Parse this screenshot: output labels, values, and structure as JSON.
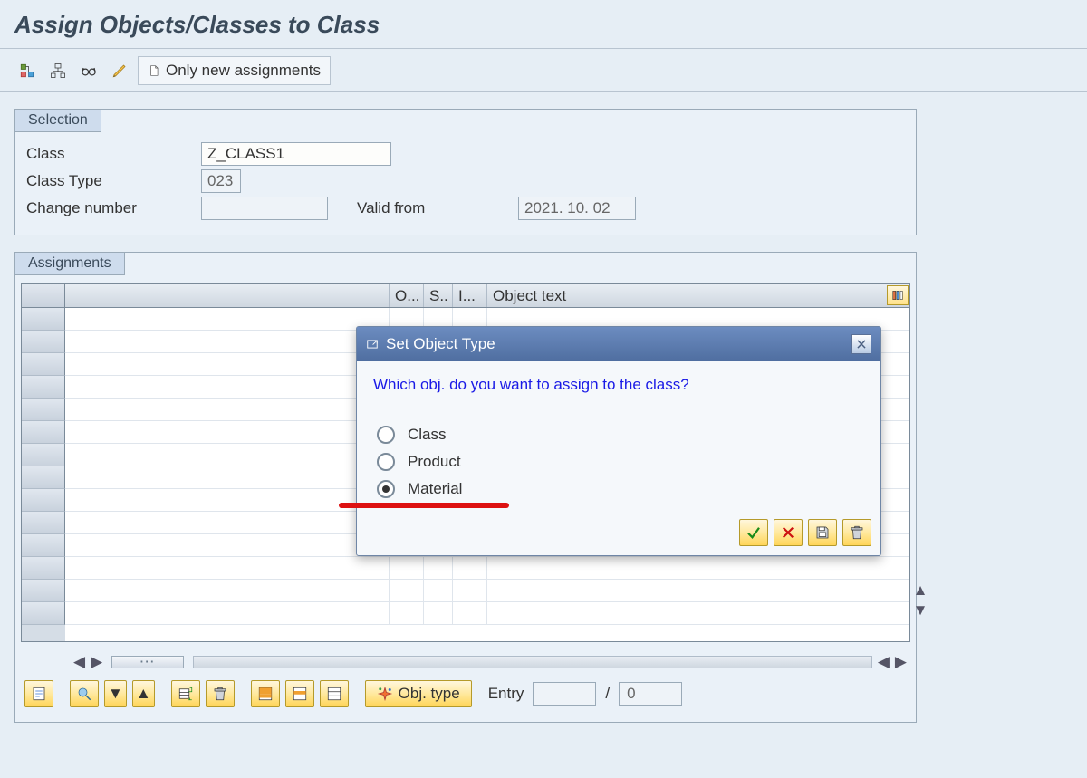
{
  "page_title": "Assign Objects/Classes to Class",
  "toolbar": {
    "only_new_label": "Only new assignments"
  },
  "selection": {
    "header": "Selection",
    "class_label": "Class",
    "class_value": "Z_CLASS1",
    "class_type_label": "Class Type",
    "class_type_value": "023",
    "change_number_label": "Change number",
    "change_number_value": "",
    "valid_from_label": "Valid from",
    "valid_from_value": "2021. 10. 02"
  },
  "assignments": {
    "header": "Assignments",
    "columns": {
      "blank": "",
      "o": "O...",
      "s": "S..",
      "i": "I...",
      "object_text": "Object text"
    }
  },
  "bottom": {
    "obj_type_label": "Obj. type",
    "entry_label": "Entry",
    "entry_current": "",
    "entry_sep": "/",
    "entry_total": "0"
  },
  "modal": {
    "title": "Set Object Type",
    "prompt": "Which obj. do you want to assign to the class?",
    "options": {
      "class": "Class",
      "product": "Product",
      "material": "Material"
    },
    "selected": "material"
  }
}
